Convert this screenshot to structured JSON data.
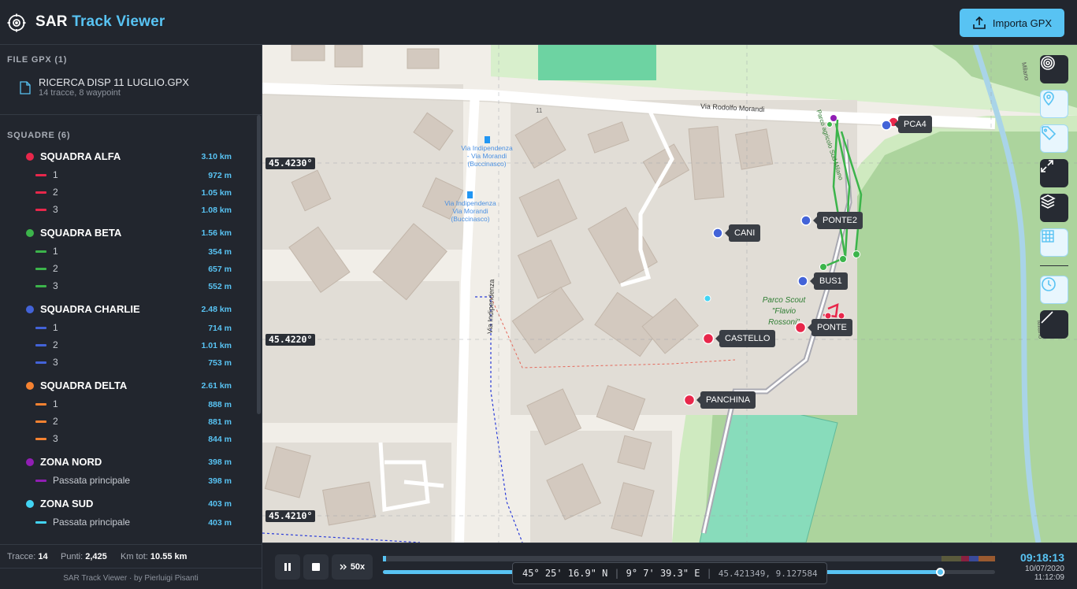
{
  "app": {
    "title_main": "SAR",
    "title_accent": "Track Viewer",
    "import_label": "Importa GPX"
  },
  "files": {
    "section_label": "FILE GPX (1)",
    "items": [
      {
        "name": "RICERCA DISP 11 LUGLIO.GPX",
        "meta": "14 tracce, 8 waypoint"
      }
    ]
  },
  "teams": {
    "section_label": "SQUADRE (6)",
    "items": [
      {
        "name": "SQUADRA ALFA",
        "km": "3.10 km",
        "color": "#e8274b",
        "tracks": [
          {
            "name": "1",
            "km": "972 m"
          },
          {
            "name": "2",
            "km": "1.05 km"
          },
          {
            "name": "3",
            "km": "1.08 km"
          }
        ]
      },
      {
        "name": "SQUADRA BETA",
        "km": "1.56 km",
        "color": "#3cb44b",
        "tracks": [
          {
            "name": "1",
            "km": "354 m"
          },
          {
            "name": "2",
            "km": "657 m"
          },
          {
            "name": "3",
            "km": "552 m"
          }
        ]
      },
      {
        "name": "SQUADRA CHARLIE",
        "km": "2.48 km",
        "color": "#4363d8",
        "tracks": [
          {
            "name": "1",
            "km": "714 m"
          },
          {
            "name": "2",
            "km": "1.01 km"
          },
          {
            "name": "3",
            "km": "753 m"
          }
        ]
      },
      {
        "name": "SQUADRA DELTA",
        "km": "2.61 km",
        "color": "#f58231",
        "tracks": [
          {
            "name": "1",
            "km": "888 m"
          },
          {
            "name": "2",
            "km": "881 m"
          },
          {
            "name": "3",
            "km": "844 m"
          }
        ]
      },
      {
        "name": "ZONA NORD",
        "km": "398 m",
        "color": "#911eb4",
        "tracks": [
          {
            "name": "Passata principale",
            "km": "398 m"
          }
        ]
      },
      {
        "name": "ZONA SUD",
        "km": "403 m",
        "color": "#42d4f4",
        "tracks": [
          {
            "name": "Passata principale",
            "km": "403 m"
          }
        ]
      }
    ]
  },
  "stats": {
    "tracks_label": "Tracce:",
    "tracks_value": "14",
    "points_label": "Punti:",
    "points_value": "2,425",
    "km_label": "Km tot:",
    "km_value": "10.55 km"
  },
  "credit": "SAR Track Viewer · by Pierluigi Pisanti",
  "map": {
    "lat_labels": [
      "45.4230°",
      "45.4220°",
      "45.4210°"
    ],
    "street_labels": {
      "morandi": "Via Rodolfo Morandi",
      "indipendenza": "Via Indipendenza",
      "parco_agricolo": "Parco agricolo Sud Milano",
      "milano": "Milano",
      "naviglio": "Milano",
      "number": "11"
    },
    "bus_stop_1": [
      "Via Indipendenza",
      "- Via Morandi",
      "(Buccinasco)"
    ],
    "bus_stop_2": [
      "Via Indipendenza",
      "Via Morandi",
      "(Buccinasco)"
    ],
    "park_name": [
      "Parco Scout",
      "\"Flavio",
      "Rossoni\""
    ],
    "waypoints": [
      {
        "name": "PCA4",
        "color": "#e8274b"
      },
      {
        "name": "PONTE2",
        "color": "#4363d8"
      },
      {
        "name": "CANI",
        "color": "#4363d8"
      },
      {
        "name": "BUS1",
        "color": "#4363d8"
      },
      {
        "name": "PONTE",
        "color": "#e8274b"
      },
      {
        "name": "CASTELLO",
        "color": "#e8274b"
      },
      {
        "name": "PANCHINA",
        "color": "#e8274b"
      }
    ],
    "tools": [
      "target-icon",
      "map-pin-icon",
      "tag-icon",
      "expand-icon",
      "layers-icon",
      "grid-icon",
      "clock-icon",
      "ruler-line-icon"
    ]
  },
  "playback": {
    "speed": "50x",
    "progress": 0.91,
    "coord_lat": "45° 25' 16.9\" N",
    "coord_lon": "9° 7' 39.3\" E",
    "coord_decimal": "45.421349, 9.127584",
    "time": "09:18:13",
    "date": "10/07/2020",
    "end_time": "11:12:09"
  }
}
